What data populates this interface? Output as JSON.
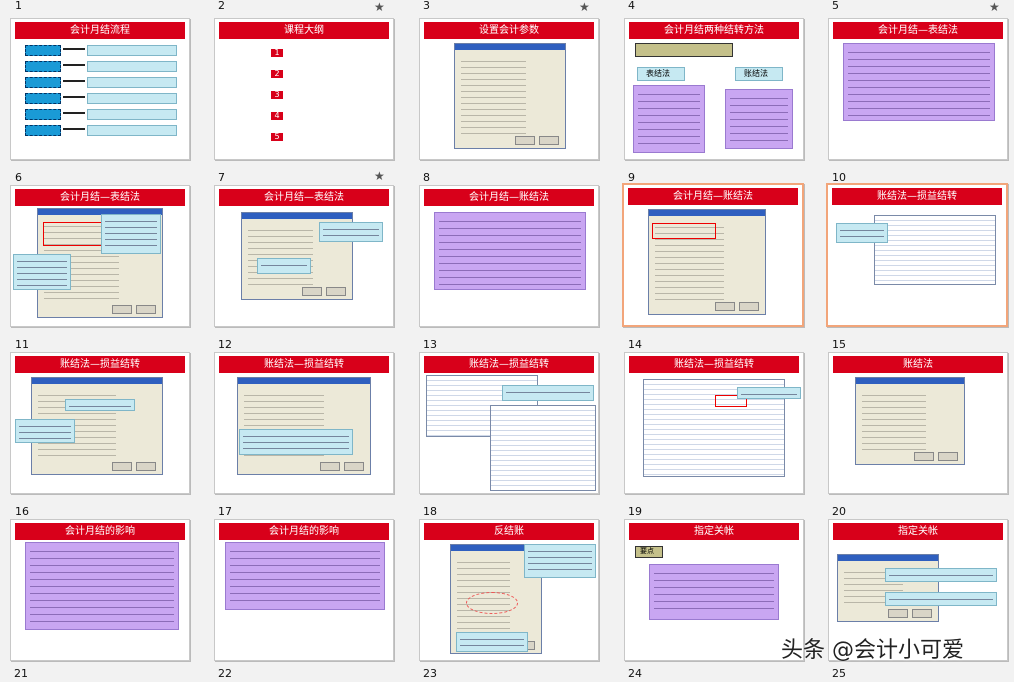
{
  "slides": [
    {
      "num": "1",
      "title": "会计月结流程",
      "star": false
    },
    {
      "num": "2",
      "title": "课程大纲",
      "star": true
    },
    {
      "num": "3",
      "title": "设置会计参数",
      "star": true
    },
    {
      "num": "4",
      "title": "会计月结两种结转方法",
      "star": false
    },
    {
      "num": "5",
      "title": "会计月结—表结法",
      "star": true
    },
    {
      "num": "6",
      "title": "会计月结—表结法",
      "star": false
    },
    {
      "num": "7",
      "title": "会计月结—表结法",
      "star": true
    },
    {
      "num": "8",
      "title": "会计月结—账结法",
      "star": false
    },
    {
      "num": "9",
      "title": "会计月结—账结法",
      "star": false
    },
    {
      "num": "10",
      "title": "账结法—损益结转",
      "star": false
    },
    {
      "num": "11",
      "title": "账结法—损益结转",
      "star": false
    },
    {
      "num": "12",
      "title": "账结法—损益结转",
      "star": false
    },
    {
      "num": "13",
      "title": "账结法—损益结转",
      "star": false
    },
    {
      "num": "14",
      "title": "账结法—损益结转",
      "star": false
    },
    {
      "num": "15",
      "title": "账结法",
      "star": false
    },
    {
      "num": "16",
      "title": "会计月结的影响",
      "star": false
    },
    {
      "num": "17",
      "title": "会计月结的影响",
      "star": false
    },
    {
      "num": "18",
      "title": "反结账",
      "star": false
    },
    {
      "num": "19",
      "title": "指定关帐",
      "star": false
    },
    {
      "num": "20",
      "title": "指定关帐",
      "star": false
    }
  ],
  "bottom_numbers": [
    "21",
    "22",
    "23",
    "24",
    "25"
  ],
  "slide4_labels": {
    "left": "表结法",
    "right": "账结法"
  },
  "slide19_badge": "要点",
  "star_glyph": "★",
  "watermark": "头条 @会计小可爱",
  "colors": {
    "title_red": "#d8001a",
    "purple": "#c9a6f2",
    "cyan": "#c6e9f2",
    "selected_border": "#f2a57a"
  }
}
